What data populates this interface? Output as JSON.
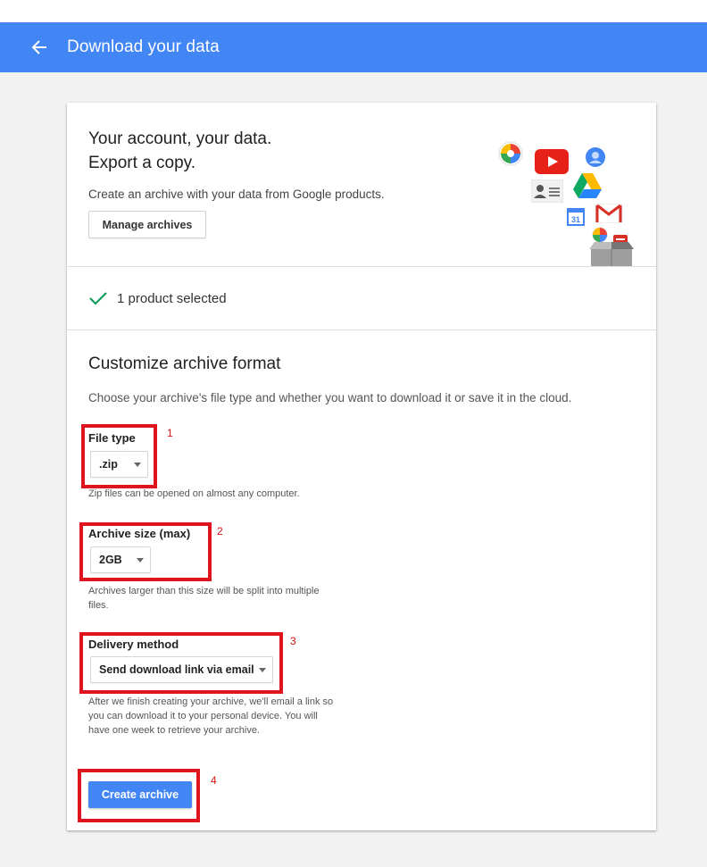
{
  "appbar": {
    "title": "Download your data",
    "back_icon": "arrow-back-icon"
  },
  "hero": {
    "title_line1": "Your account, your data.",
    "title_line2": "Export a copy.",
    "description": "Create an archive with your data from Google products.",
    "manage_button": "Manage archives",
    "illustration_icons": [
      "photos-icon",
      "youtube-icon",
      "profile-icon",
      "contacts-icon",
      "drive-icon",
      "calendar-icon",
      "gmail-icon",
      "hangouts-icon",
      "box-icon"
    ],
    "calendar_day": "31"
  },
  "selection": {
    "text": "1 product selected",
    "check_color": "#0f9d58"
  },
  "customize": {
    "title": "Customize archive format",
    "description": "Choose your archive's file type and whether you want to download it or save it in the cloud.",
    "file_type": {
      "label": "File type",
      "value": ".zip",
      "help": "Zip files can be opened on almost any computer."
    },
    "archive_size": {
      "label": "Archive size (max)",
      "value": "2GB",
      "help_line1": "Archives larger than this size will be split into multiple",
      "help_line2": "files."
    },
    "delivery": {
      "label": "Delivery method",
      "value": "Send download link via email",
      "help_line1": "After we finish creating your archive, we'll email a link so",
      "help_line2": "you can download it to your personal device. You will",
      "help_line3": "have one week to retrieve your archive."
    },
    "create_button": "Create archive"
  },
  "annotations": [
    "1",
    "2",
    "3",
    "4"
  ],
  "colors": {
    "appbar": "#4285f4",
    "primary_button": "#4285f4",
    "annotation_red": "#e0141e"
  }
}
